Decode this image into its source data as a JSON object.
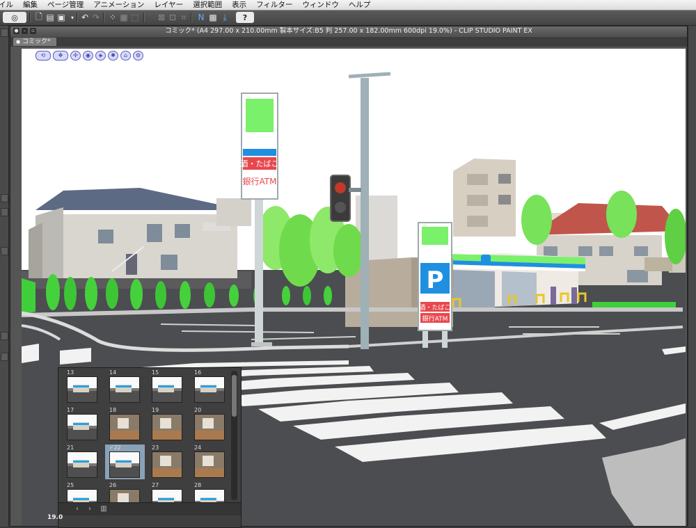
{
  "menubar": {
    "items": [
      "イル",
      "編集",
      "ページ管理",
      "アニメーション",
      "レイヤー",
      "選択範囲",
      "表示",
      "フィルター",
      "ウィンドウ",
      "ヘルプ"
    ]
  },
  "toolbar": {
    "help_label": "?"
  },
  "window": {
    "title": "コミック* (A4 297.00 x 210.00mm 製本サイズ:B5 判 257.00 x 182.00mm 600dpi 19.0%)  - CLIP STUDIO PAINT EX",
    "tab_label": "コミック*"
  },
  "scene": {
    "sign_line1": "酒・たばこ",
    "sign_line2": "銀行ATM",
    "parking_letter": "P",
    "small_sign_line1": "酒・たばこ",
    "small_sign_line2": "銀行ATM"
  },
  "page_navigator": {
    "pages": [
      {
        "num": "13",
        "kind": "store"
      },
      {
        "num": "14",
        "kind": "store"
      },
      {
        "num": "15",
        "kind": "store"
      },
      {
        "num": "16",
        "kind": "store"
      },
      {
        "num": "17",
        "kind": "store"
      },
      {
        "num": "18",
        "kind": "interior"
      },
      {
        "num": "19",
        "kind": "interior"
      },
      {
        "num": "20",
        "kind": "interior"
      },
      {
        "num": "21",
        "kind": "store"
      },
      {
        "num": "✓22",
        "kind": "store",
        "selected": true
      },
      {
        "num": "23",
        "kind": "interior"
      },
      {
        "num": "24",
        "kind": "interior"
      },
      {
        "num": "25",
        "kind": "store"
      },
      {
        "num": "26",
        "kind": "interior"
      },
      {
        "num": "27",
        "kind": "store"
      },
      {
        "num": "28",
        "kind": "store"
      }
    ],
    "zoom_label": "19.0"
  },
  "colors": {
    "accent_green": "#7bf06a",
    "sign_red": "#e8484d",
    "store_blue": "#1f8fe0",
    "road": "#4c4d50"
  }
}
